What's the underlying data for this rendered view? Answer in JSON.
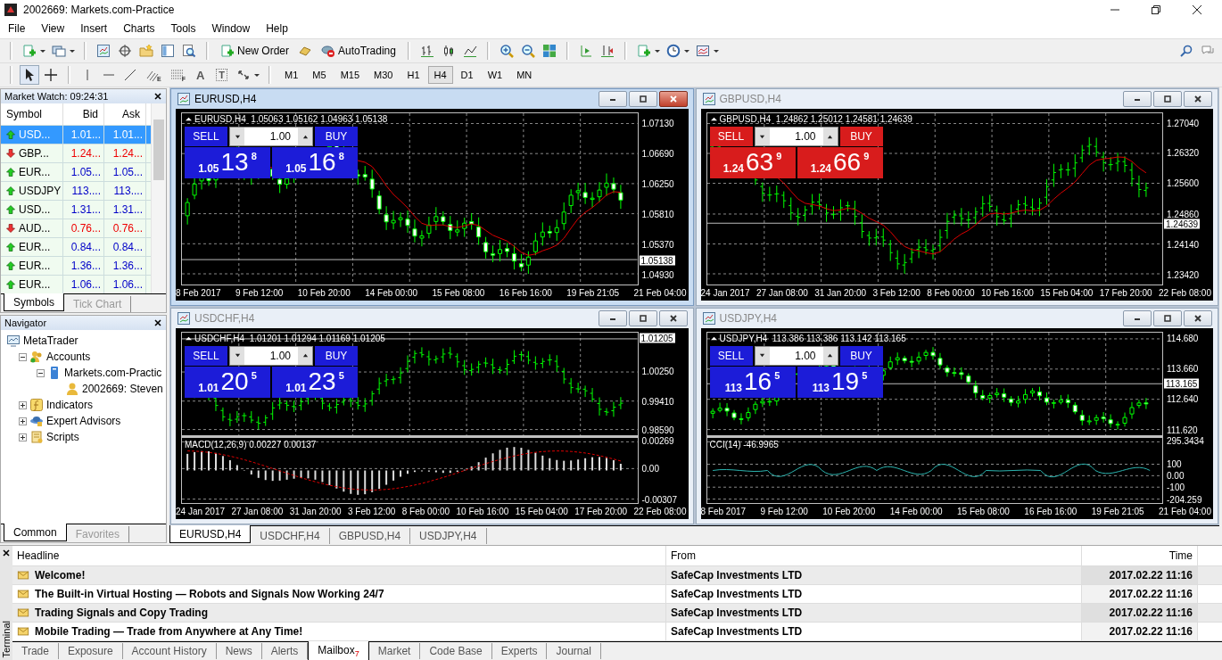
{
  "window": {
    "title": "2002669: Markets.com-Practice"
  },
  "menu": [
    "File",
    "View",
    "Insert",
    "Charts",
    "Tools",
    "Window",
    "Help"
  ],
  "toolbar": {
    "new_order": "New Order",
    "autotrading": "AutoTrading",
    "drawing_tools": [
      {
        "kind": "fan",
        "label": "E"
      },
      {
        "kind": "levels",
        "label": "F"
      },
      {
        "kind": "text",
        "label": "A"
      },
      {
        "kind": "text_label",
        "label": "T"
      }
    ],
    "timeframes": [
      {
        "label": "M1",
        "selected": false
      },
      {
        "label": "M5",
        "selected": false
      },
      {
        "label": "M15",
        "selected": false
      },
      {
        "label": "M30",
        "selected": false
      },
      {
        "label": "H1",
        "selected": false
      },
      {
        "label": "H4",
        "selected": true
      },
      {
        "label": "D1",
        "selected": false
      },
      {
        "label": "W1",
        "selected": false
      },
      {
        "label": "MN",
        "selected": false
      }
    ]
  },
  "market_watch": {
    "title": "Market Watch: 09:24:31",
    "columns": [
      "Symbol",
      "Bid",
      "Ask"
    ],
    "rows": [
      {
        "symbol": "USD...",
        "bid": "1.01...",
        "ask": "1.01...",
        "kind": "up",
        "selected": true
      },
      {
        "symbol": "GBP...",
        "bid": "1.24...",
        "ask": "1.24...",
        "kind": "down",
        "selected": false
      },
      {
        "symbol": "EUR...",
        "bid": "1.05...",
        "ask": "1.05...",
        "kind": "up",
        "selected": false
      },
      {
        "symbol": "USDJPY",
        "bid": "113....",
        "ask": "113....",
        "kind": "up",
        "selected": false
      },
      {
        "symbol": "USD...",
        "bid": "1.31...",
        "ask": "1.31...",
        "kind": "up",
        "selected": false
      },
      {
        "symbol": "AUD...",
        "bid": "0.76...",
        "ask": "0.76...",
        "kind": "down",
        "selected": false
      },
      {
        "symbol": "EUR...",
        "bid": "0.84...",
        "ask": "0.84...",
        "kind": "up",
        "selected": false
      },
      {
        "symbol": "EUR...",
        "bid": "1.36...",
        "ask": "1.36...",
        "kind": "up",
        "selected": false
      },
      {
        "symbol": "EUR...",
        "bid": "1.06...",
        "ask": "1.06...",
        "kind": "up",
        "selected": false
      }
    ],
    "tabs": [
      {
        "label": "Symbols",
        "selected": true
      },
      {
        "label": "Tick Chart",
        "selected": false
      }
    ]
  },
  "navigator": {
    "title": "Navigator",
    "tree": [
      {
        "label": "MetaTrader",
        "children": [
          {
            "label": "Accounts",
            "expanded": true,
            "children": [
              {
                "label": "Markets.com-Practic",
                "expanded": true,
                "children": [
                  {
                    "label": "2002669: Steven"
                  }
                ]
              }
            ]
          },
          {
            "label": "Indicators",
            "expanded": false
          },
          {
            "label": "Expert Advisors",
            "expanded": false
          },
          {
            "label": "Scripts",
            "expanded": false
          }
        ]
      }
    ],
    "tabs": [
      {
        "label": "Common",
        "selected": true
      },
      {
        "label": "Favorites",
        "selected": false
      }
    ]
  },
  "charts": [
    {
      "title": "EURUSD,H4",
      "active": true,
      "kind": "candles",
      "moving_average": true,
      "color": "#1c1cd8",
      "info": "EURUSD,H4  1.05063 1.05162 1.04963 1.05138",
      "sell_label": "SELL",
      "buy_label": "BUY",
      "lot": "1.00",
      "sell_price": {
        "prefix": "1.05",
        "big": "13",
        "pip": "8"
      },
      "buy_price": {
        "prefix": "1.05",
        "big": "16",
        "pip": "8"
      },
      "price_labels": [
        "1.07130",
        "1.06690",
        "1.06250",
        "1.05810",
        "1.05370",
        "1.04930"
      ],
      "current_price": "1.05138",
      "time_labels": [
        "8 Feb 2017",
        "9 Feb 12:00",
        "10 Feb 20:00",
        "14 Feb 00:00",
        "15 Feb 08:00",
        "16 Feb 16:00",
        "19 Feb 21:05",
        "21 Feb 04:00"
      ]
    },
    {
      "title": "GBPUSD,H4",
      "active": false,
      "kind": "bars",
      "moving_average": true,
      "color": "#d81c1c",
      "info": "GBPUSD,H4  1.24862 1.25012 1.24581 1.24639",
      "sell_label": "SELL",
      "buy_label": "BUY",
      "lot": "1.00",
      "sell_price": {
        "prefix": "1.24",
        "big": "63",
        "pip": "9"
      },
      "buy_price": {
        "prefix": "1.24",
        "big": "66",
        "pip": "9"
      },
      "price_labels": [
        "1.27040",
        "1.26320",
        "1.25600",
        "1.24860",
        "1.24140",
        "1.23420"
      ],
      "current_price": "1.24639",
      "time_labels": [
        "24 Jan 2017",
        "27 Jan 08:00",
        "31 Jan 20:00",
        "3 Feb 12:00",
        "8 Feb 00:00",
        "10 Feb 16:00",
        "15 Feb 04:00",
        "17 Feb 20:00",
        "22 Feb 08:00"
      ]
    },
    {
      "title": "USDCHF,H4",
      "active": false,
      "kind": "bars",
      "moving_average": false,
      "color": "#1c1cd8",
      "info": "USDCHF,H4  1.01201 1.01294 1.01169 1.01205",
      "sell_label": "SELL",
      "buy_label": "BUY",
      "lot": "1.00",
      "sell_price": {
        "prefix": "1.01",
        "big": "20",
        "pip": "5"
      },
      "buy_price": {
        "prefix": "1.01",
        "big": "23",
        "pip": "5"
      },
      "price_labels": [
        "1.00250",
        "0.99410",
        "0.98590"
      ],
      "current_price": "1.01205",
      "indicator": {
        "kind": "macd",
        "label": "MACD(12,26,9) 0.00227 0.00137",
        "levels": [
          "0.00269",
          "0.00",
          "-0.00307"
        ]
      },
      "time_labels": [
        "24 Jan 2017",
        "27 Jan 08:00",
        "31 Jan 20:00",
        "3 Feb 12:00",
        "8 Feb 00:00",
        "10 Feb 16:00",
        "15 Feb 04:00",
        "17 Feb 20:00",
        "22 Feb 08:00"
      ]
    },
    {
      "title": "USDJPY,H4",
      "active": false,
      "kind": "candles",
      "moving_average": false,
      "color": "#1c1cd8",
      "info": "USDJPY,H4  113.386 113.386 113.142 113.165",
      "sell_label": "SELL",
      "buy_label": "BUY",
      "lot": "1.00",
      "sell_price": {
        "prefix": "113",
        "big": "16",
        "pip": "5"
      },
      "buy_price": {
        "prefix": "113",
        "big": "19",
        "pip": "5"
      },
      "price_labels": [
        "114.680",
        "113.660",
        "112.640",
        "111.620"
      ],
      "current_price": "113.165",
      "indicator": {
        "kind": "cci",
        "label": "CCI(14) -46.9965",
        "levels": [
          "295.3434",
          "100",
          "0.00",
          "-100",
          "-204.259"
        ]
      },
      "time_labels": [
        "8 Feb 2017",
        "9 Feb 12:00",
        "10 Feb 20:00",
        "14 Feb 00:00",
        "15 Feb 08:00",
        "16 Feb 16:00",
        "19 Feb 21:05",
        "21 Feb 04:00"
      ]
    }
  ],
  "chart_tabs": [
    {
      "label": "EURUSD,H4",
      "selected": true
    },
    {
      "label": "USDCHF,H4",
      "selected": false
    },
    {
      "label": "GBPUSD,H4",
      "selected": false
    },
    {
      "label": "USDJPY,H4",
      "selected": false
    }
  ],
  "terminal": {
    "side_label": "Terminal",
    "columns": [
      "Headline",
      "From",
      "Time"
    ],
    "rows": [
      {
        "headline": "Welcome!",
        "from": "SafeCap Investments LTD",
        "time": "2017.02.22 11:16"
      },
      {
        "headline": "The Built-in Virtual Hosting — Robots and Signals Now Working 24/7",
        "from": "SafeCap Investments LTD",
        "time": "2017.02.22 11:16"
      },
      {
        "headline": "Trading Signals and Copy Trading",
        "from": "SafeCap Investments LTD",
        "time": "2017.02.22 11:16"
      },
      {
        "headline": "Mobile Trading — Trade from Anywhere at Any Time!",
        "from": "SafeCap Investments LTD",
        "time": "2017.02.22 11:16"
      }
    ],
    "tabs": [
      {
        "label": "Trade",
        "selected": false
      },
      {
        "label": "Exposure",
        "selected": false
      },
      {
        "label": "Account History",
        "selected": false
      },
      {
        "label": "News",
        "selected": false
      },
      {
        "label": "Alerts",
        "selected": false
      },
      {
        "label": "Mailbox",
        "selected": true,
        "badge": "7"
      },
      {
        "label": "Market",
        "selected": false
      },
      {
        "label": "Code Base",
        "selected": false
      },
      {
        "label": "Experts",
        "selected": false
      },
      {
        "label": "Journal",
        "selected": false
      }
    ]
  }
}
